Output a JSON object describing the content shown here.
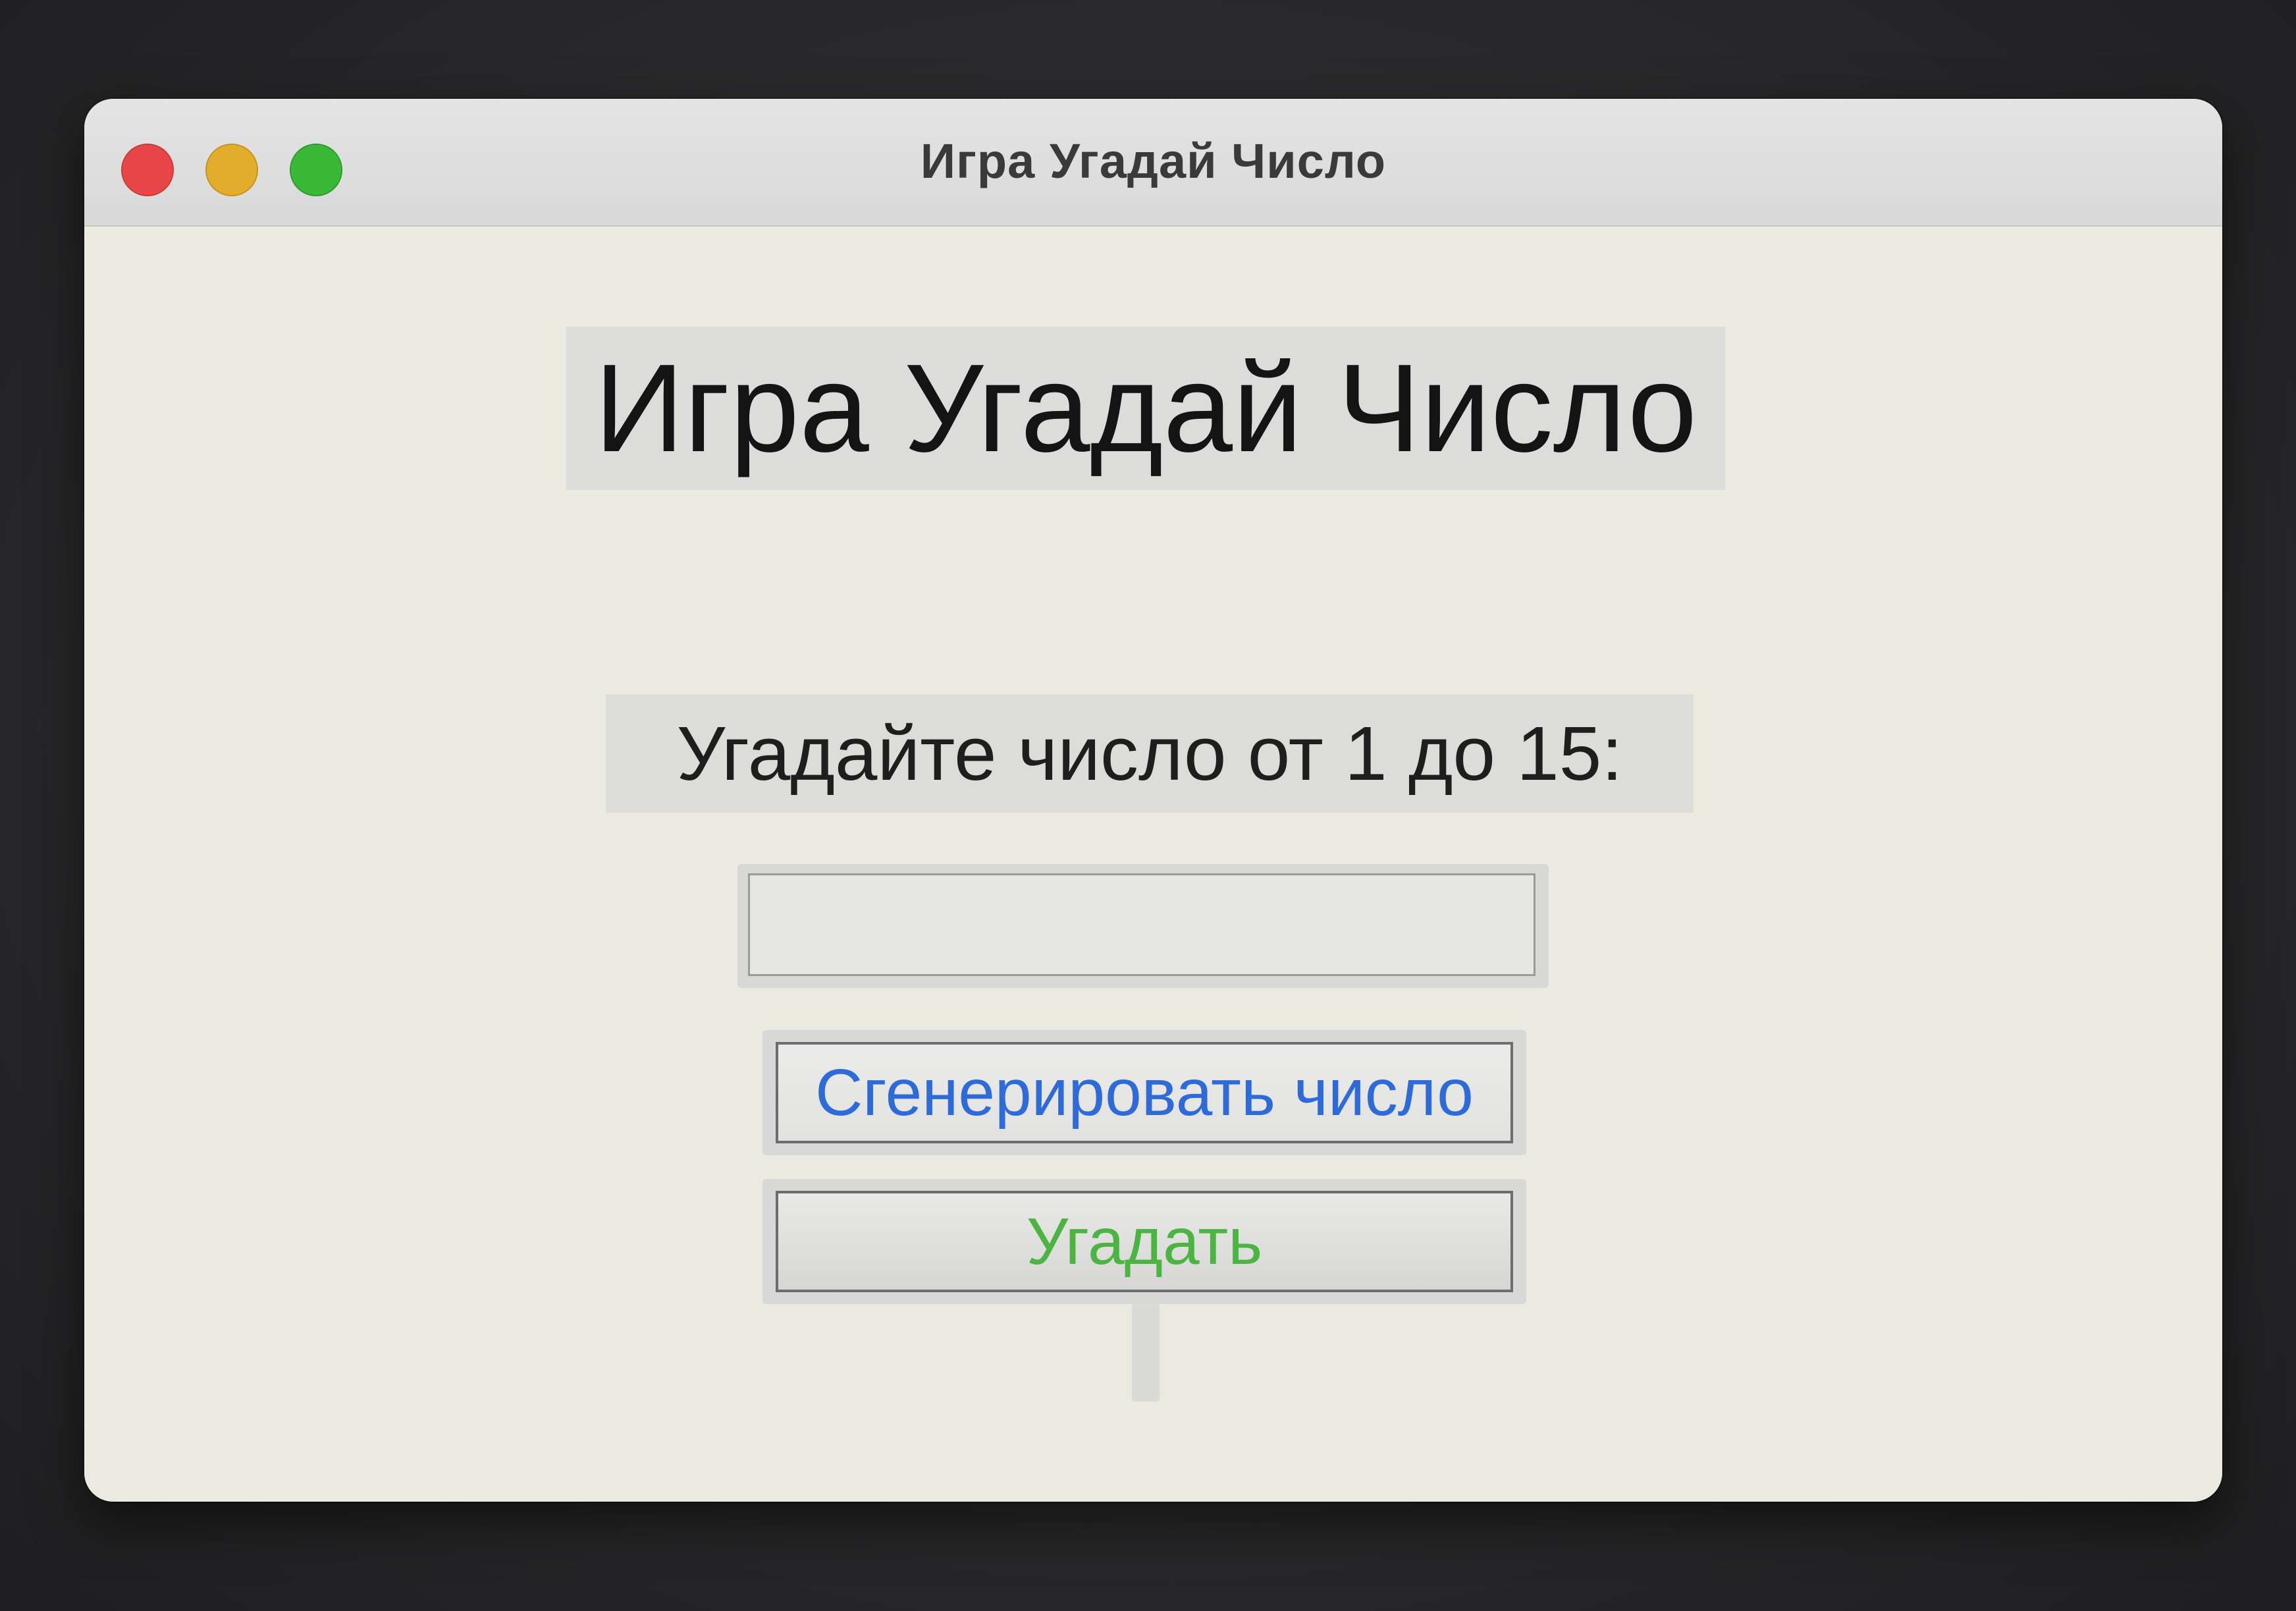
{
  "window": {
    "title": "Игра Угадай Число"
  },
  "main": {
    "heading": "Игра Угадай Число",
    "prompt": "Угадайте число от 1 до 15:",
    "guess_input": {
      "value": "",
      "placeholder": ""
    },
    "generate_button_label": "Сгенерировать число",
    "guess_button_label": "Угадать",
    "result_text": ""
  },
  "colors": {
    "generate_button_text": "#2f6bd8",
    "guess_button_text": "#4bb443",
    "traffic_close": "#e8474a",
    "traffic_minimize": "#e3ad2c",
    "traffic_zoom": "#3cb838"
  }
}
